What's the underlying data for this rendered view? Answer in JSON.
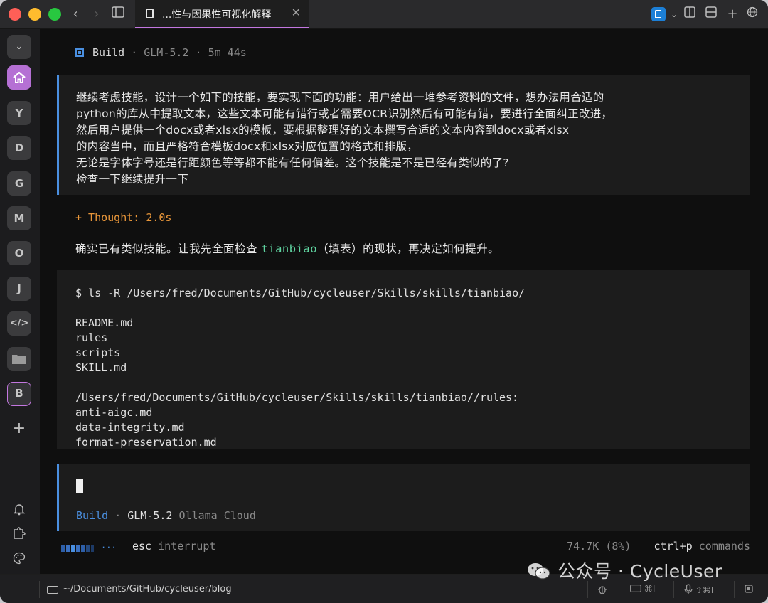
{
  "titlebar": {
    "tab_title": "...性与因果性可视化解释",
    "tab_close": "✕"
  },
  "sidebar": {
    "items": [
      {
        "label": "⌄",
        "icon": "chevron-down-icon"
      },
      {
        "label": "⌂",
        "icon": "home-icon"
      },
      {
        "label": "Y"
      },
      {
        "label": "D"
      },
      {
        "label": "G"
      },
      {
        "label": "M"
      },
      {
        "label": "O"
      },
      {
        "label": "J"
      },
      {
        "label": "</>",
        "icon": "code-icon"
      },
      {
        "label": "",
        "icon": "folder-icon"
      },
      {
        "label": "B"
      },
      {
        "label": "+",
        "icon": "plus-icon"
      }
    ],
    "bottom_icons": [
      "bell-icon",
      "plugin-icon",
      "palette-icon",
      "sidebar-toggle-icon"
    ]
  },
  "session": {
    "mode": "Build",
    "model": "GLM-5.2",
    "separator": "·",
    "elapsed": "5m 44s"
  },
  "user_message": {
    "lines": [
      "继续考虑技能，设计一个如下的技能，要实现下面的功能：用户给出一堆参考资料的文件，想办法用合适的",
      "python的库从中提取文本，这些文本可能有错行或者需要OCR识别然后有可能有错，要进行全面纠正改进，",
      "然后用户提供一个docx或者xlsx的模板，要根据整理好的文本撰写合适的文本内容到docx或者xlsx",
      "的内容当中，而且严格符合模板docx和xlsx对应位置的格式和排版，",
      "无论是字体字号还是行距颜色等等都不能有任何偏差。这个技能是不是已经有类似的了?",
      "检查一下继续提升一下"
    ]
  },
  "thought": "+ Thought: 2.0s",
  "reply": {
    "before": "确实已有类似技能。让我先全面检查 ",
    "highlight": "tianbiao",
    "after": "（填表）的现状，再决定如何提升。"
  },
  "command": {
    "prompt": "$ ls -R /Users/fred/Documents/GitHub/cycleuser/Skills/skills/tianbiao/",
    "output_group1": [
      "README.md",
      "rules",
      "scripts",
      "SKILL.md"
    ],
    "output_group2_header": "/Users/fred/Documents/GitHub/cycleuser/Skills/skills/tianbiao//rules:",
    "output_group2": [
      "anti-aigc.md",
      "data-integrity.md",
      "format-preservation.md"
    ]
  },
  "input": {
    "mode": "Build",
    "separator": "·",
    "model": "GLM-5.2",
    "provider": "Ollama Cloud"
  },
  "footer": {
    "esc_key": "esc",
    "esc_action": "interrupt",
    "tokens": "74.7K (8%)",
    "cmd_key": "ctrl+p",
    "cmd_action": "commands"
  },
  "statusbar": {
    "path": "~/Documents/GitHub/cycleuser/blog",
    "shortcut1": "⌘I",
    "shortcut2": "⇧⌘I"
  },
  "watermark": "公众号 · CycleUser",
  "colors": {
    "accent": "#c377e0",
    "blue": "#4a8fe0",
    "thought": "#e8963a",
    "highlight": "#5fd3a0"
  }
}
